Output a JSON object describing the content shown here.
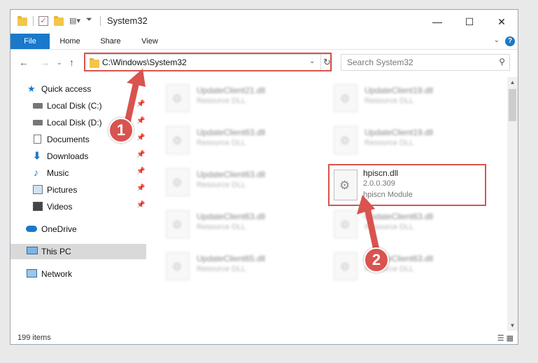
{
  "window": {
    "title": "System32",
    "controls": {
      "minimize": "—",
      "maximize": "☐",
      "close": "✕"
    }
  },
  "ribbon": {
    "tabs": [
      "File",
      "Home",
      "Share",
      "View"
    ],
    "help": "?"
  },
  "address": {
    "path": "C:\\Windows\\System32",
    "search_placeholder": "Search System32"
  },
  "nav": {
    "items": [
      {
        "label": "Quick access",
        "icon": "star-icon",
        "pinned": false
      },
      {
        "label": "Local Disk (C:)",
        "icon": "drive-icon",
        "pinned": true
      },
      {
        "label": "Local Disk (D:)",
        "icon": "drive-icon",
        "pinned": true
      },
      {
        "label": "Documents",
        "icon": "documents-icon",
        "pinned": true
      },
      {
        "label": "Downloads",
        "icon": "download-icon",
        "pinned": true
      },
      {
        "label": "Music",
        "icon": "music-icon",
        "pinned": true
      },
      {
        "label": "Pictures",
        "icon": "pictures-icon",
        "pinned": true
      },
      {
        "label": "Videos",
        "icon": "videos-icon",
        "pinned": true
      },
      {
        "label": "OneDrive",
        "icon": "cloud-icon",
        "pinned": false
      },
      {
        "label": "This PC",
        "icon": "computer-icon",
        "pinned": false
      },
      {
        "label": "Network",
        "icon": "network-icon",
        "pinned": false
      }
    ]
  },
  "files": [
    {
      "name": "UpdateClient21.dll",
      "desc": "Resource DLL"
    },
    {
      "name": "UpdateClient19.dll",
      "desc": "Resource DLL"
    },
    {
      "name": "UpdateClient63.dll",
      "desc": "Resource DLL"
    },
    {
      "name": "UpdateClient19.dll",
      "desc": "Resource DLL"
    },
    {
      "name": "UpdateClient63.dll",
      "desc": "Resource DLL"
    },
    {
      "name": "UpdateClient63.dll",
      "desc": "Resource DLL"
    },
    {
      "name": "UpdateClient63.dll",
      "desc": "Resource DLL"
    },
    {
      "name": "UpdateClient65.dll",
      "desc": "Resource DLL"
    },
    {
      "name": "UpdateClient63.dll",
      "desc": "Resource DLL"
    }
  ],
  "highlighted_file": {
    "name": "hpiscn.dll",
    "version": "2.0.0.309",
    "description": "hpiscn Module"
  },
  "status": {
    "items": "199 items"
  },
  "annotations": {
    "step1": "1",
    "step2": "2",
    "color": "#d9534f"
  }
}
